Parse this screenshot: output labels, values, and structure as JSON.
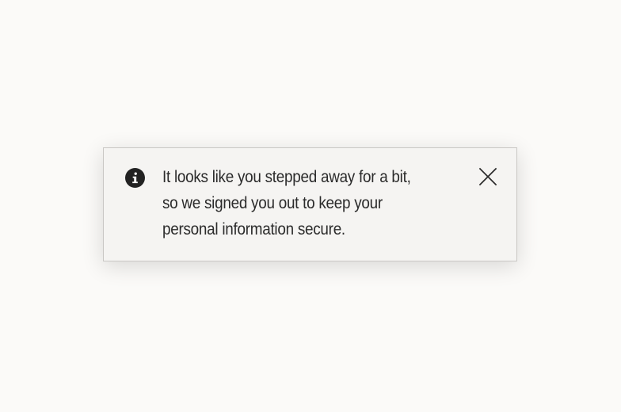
{
  "notification": {
    "type": "info",
    "icon": "info-icon",
    "message_lines": [
      "It looks like you stepped away for a bit,",
      "so we signed you out to keep your",
      "personal information secure."
    ],
    "close_icon": "close-icon",
    "colors": {
      "page_background": "#fbfaf8",
      "panel_background": "#f5f4f2",
      "panel_border": "#c9c7c4",
      "text": "#2b2b2b",
      "icon": "#222222"
    }
  }
}
